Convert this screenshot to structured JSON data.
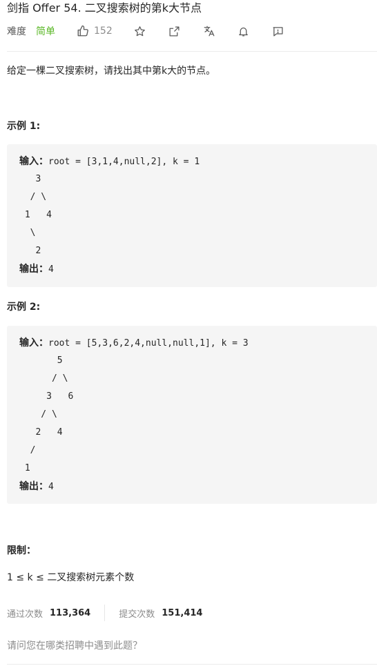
{
  "title": "剑指 Offer 54. 二叉搜索树的第k大节点",
  "meta": {
    "difficulty_label": "难度",
    "difficulty": "简单",
    "likes": "152",
    "icons": [
      "thumbs-up-icon",
      "star-icon",
      "share-icon",
      "translate-icon",
      "bell-icon",
      "feedback-icon"
    ]
  },
  "description": "给定一棵二叉搜索树，请找出其中第k大的节点。",
  "examples": [
    {
      "title": "示例 1:",
      "input_label": "输入：",
      "input": "root = [3,1,4,null,2], k = 1",
      "tree": [
        "   3",
        "  / \\",
        " 1   4",
        "  \\",
        "   2"
      ],
      "output_label": "输出：",
      "output": "4"
    },
    {
      "title": "示例 2:",
      "input_label": "输入：",
      "input": "root = [5,3,6,2,4,null,null,1], k = 3",
      "tree": [
        "       5",
        "      / \\",
        "     3   6",
        "    / \\",
        "   2   4",
        "  /",
        " 1"
      ],
      "output_label": "输出：",
      "output": "4"
    }
  ],
  "limits": {
    "title": "限制：",
    "text": "1 ≤ k ≤ 二叉搜索树元素个数"
  },
  "stats": {
    "accepted_label": "通过次数",
    "accepted": "113,364",
    "submitted_label": "提交次数",
    "submitted": "151,414"
  },
  "question": "请问您在哪类招聘中遇到此题？"
}
